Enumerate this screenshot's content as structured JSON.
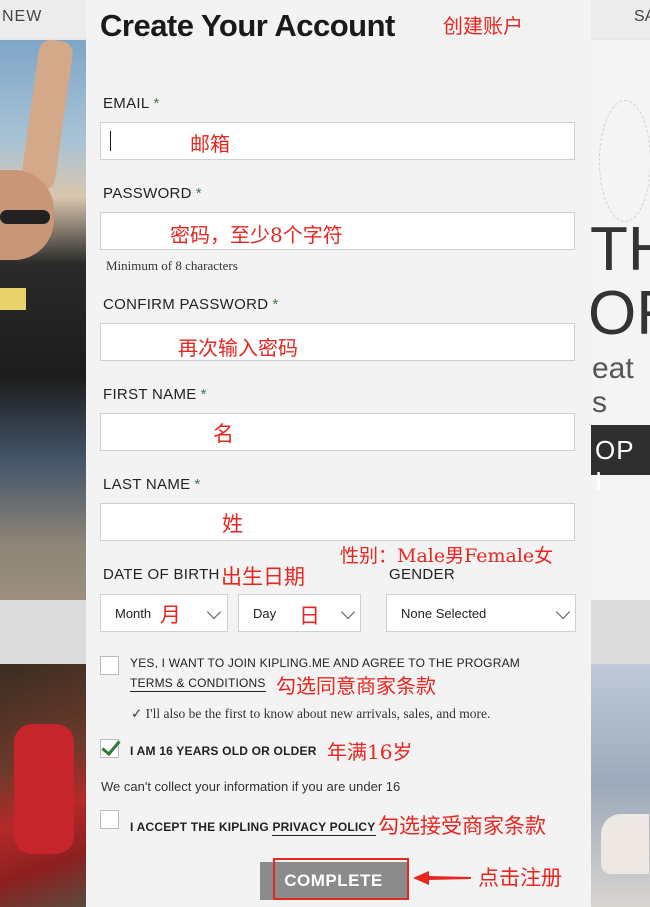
{
  "background": {
    "nav_left": "NEW",
    "nav_right": "SA",
    "hero_line1": "TH",
    "hero_line2": "OR",
    "hero_line3": "eat s",
    "shop_button": "OP I"
  },
  "form": {
    "title": "Create Your Account",
    "email": {
      "label": "EMAIL",
      "required": "*",
      "value": ""
    },
    "password": {
      "label": "PASSWORD",
      "required": "*",
      "value": "",
      "hint": "Minimum of 8 characters"
    },
    "confirm_password": {
      "label": "CONFIRM PASSWORD",
      "required": "*",
      "value": ""
    },
    "first_name": {
      "label": "FIRST NAME",
      "required": "*",
      "value": ""
    },
    "last_name": {
      "label": "LAST NAME",
      "required": "*",
      "value": ""
    },
    "date_of_birth": {
      "label": "DATE OF BIRTH",
      "month": "Month",
      "day": "Day"
    },
    "gender": {
      "label": "GENDER",
      "selected": "None Selected"
    },
    "program_opt_in": {
      "checked": false,
      "text": "YES, I WANT TO JOIN KIPLING.ME AND AGREE TO THE PROGRAM",
      "link": "TERMS & CONDITIONS",
      "note": "✓ I'll also be the first to know about new arrivals, sales, and more."
    },
    "age_check": {
      "checked": true,
      "text": "I AM 16 YEARS OLD OR OLDER"
    },
    "age_note": "We can't collect your information if you are under 16",
    "privacy": {
      "checked": false,
      "text": "I ACCEPT THE KIPLING",
      "link": "PRIVACY POLICY"
    },
    "submit": "COMPLETE"
  },
  "annotations": {
    "title": "创建账户",
    "email": "邮箱",
    "password": "密码，至少8个字符",
    "confirm": "再次输入密码",
    "first_name": "名",
    "last_name": "姓",
    "gender": "性别：Male男Female女",
    "dob": "出生日期",
    "month": "月",
    "day": "日",
    "terms": "勾选同意商家条款",
    "age": "年满16岁",
    "privacy": "勾选接受商家条款",
    "submit": "点击注册"
  },
  "colors": {
    "annotation": "#e8261f",
    "required": "#3a7a4d",
    "check": "#2e7d32",
    "button": "#8b8b8b"
  }
}
